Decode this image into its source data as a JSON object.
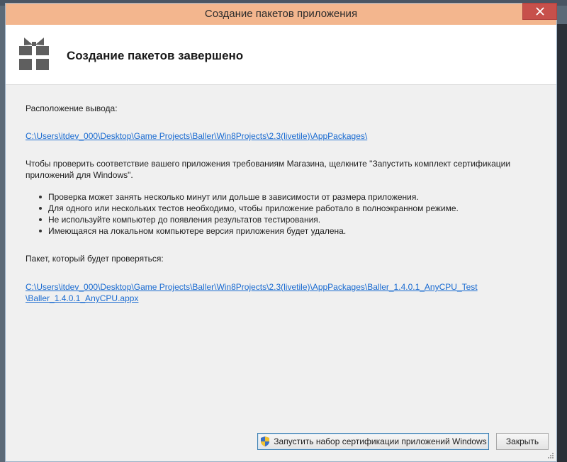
{
  "window": {
    "title": "Создание пакетов приложения",
    "close_label": "✕"
  },
  "header": {
    "title": "Создание пакетов завершено",
    "icon": "gift-icon"
  },
  "body": {
    "output_label": "Расположение вывода:",
    "output_path": "C:\\Users\\itdev_000\\Desktop\\Game Projects\\Baller\\Win8Projects\\2.3(livetile)\\AppPackages\\",
    "instructions_line1": "Чтобы проверить соответствие вашего приложения требованиям Магазина, щелкните \"Запустить комплект сертификации",
    "instructions_line2": "приложений для Windows\".",
    "bullets": [
      "Проверка может занять несколько минут или дольше в зависимости от размера приложения.",
      "Для одного или нескольких тестов необходимо, чтобы приложение работало в полноэкранном режиме.",
      "Не используйте компьютер до появления результатов тестирования.",
      "Имеющаяся на локальном компьютере версия приложения будет удалена."
    ],
    "package_label": "Пакет, который будет проверяться:",
    "package_path_line1": "C:\\Users\\itdev_000\\Desktop\\Game Projects\\Baller\\Win8Projects\\2.3(livetile)\\AppPackages\\Baller_1.4.0.1_AnyCPU_Test",
    "package_path_line2": "\\Baller_1.4.0.1_AnyCPU.appx"
  },
  "buttons": {
    "launch_wack": "Запустить набор сертификации приложений Windows",
    "close": "Закрыть"
  },
  "colors": {
    "titlebar": "#f3b68e",
    "close_button": "#c7504b",
    "link": "#1a6bd1"
  }
}
